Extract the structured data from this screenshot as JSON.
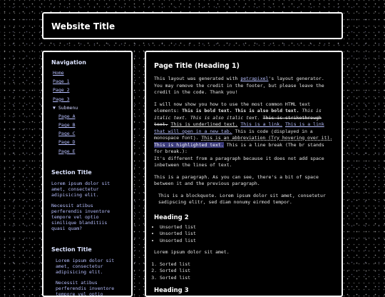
{
  "site_title": "Website Title",
  "sidebar": {
    "nav_title": "Navigation",
    "items": [
      "Home",
      "Page 1",
      "Page 2",
      "Page 3"
    ],
    "submenu_label": "▼ Submenu",
    "subitems": [
      "Page A",
      "Page B",
      "Page C",
      "Page D",
      "Page E"
    ],
    "section1": {
      "title": "Section Title",
      "p1": "Lorem ipsum dolor sit amet, consectetur adipisicing elit.",
      "p2": "Necessit atibus perferendis inventore tempore vel optio similique blanditiis quasi quam?"
    },
    "section2": {
      "title": "Section Title",
      "p1": "Lorem ipsum dolor sit amet, consectetur adipisicing elit.",
      "p2": "Necessit atibus perferendis inventore tempore vel optio"
    }
  },
  "main": {
    "title": "Page Title (Heading 1)",
    "intro_a": "This layout was generated with ",
    "intro_link": "petrapixel",
    "intro_b": "'s layout generator. You may remove the credit in the footer, but please leave the credit in the code. Thank you!",
    "demo_lead": "I will now show you how to use the most common HTML text elements: ",
    "bold": "This is bold text.",
    "bold2": "This is also bold text.",
    "italic": "This is italic text.",
    "italic2": "This is also italic text.",
    "strike": "This is strikethrough text.",
    "underline": "This is underlined text.",
    "link": "This is a link.",
    "link_new_tab": "This is a link that will open in a new tab.",
    "code": "This is code (displayed in a monospace font).",
    "abbr": "This is an abbreviation (Try hovering over it).",
    "highlight": "This is highlighted text.",
    "linebreak1": "This is a line break (The br stands for break.):",
    "linebreak2": "It's different from a paragraph because it does not add space inbetween the lines of text.",
    "para": "This is a paragraph. As you can see, there's a bit of space between it and the previous paragraph.",
    "blockquote": "This is a blockquote. Lorem ipsum dolor sit amet, consetetur sadipscing elitr, sed diam nonumy eirmod tempor.",
    "h2": "Heading 2",
    "unsorted": [
      "Unsorted list",
      "Unsorted list",
      "Unsorted list"
    ],
    "lorem": "Lorem ipsum dolor sit amet.",
    "sorted": [
      "Sorted list",
      "Sorted list",
      "Sorted list"
    ],
    "h3": "Heading 3"
  }
}
